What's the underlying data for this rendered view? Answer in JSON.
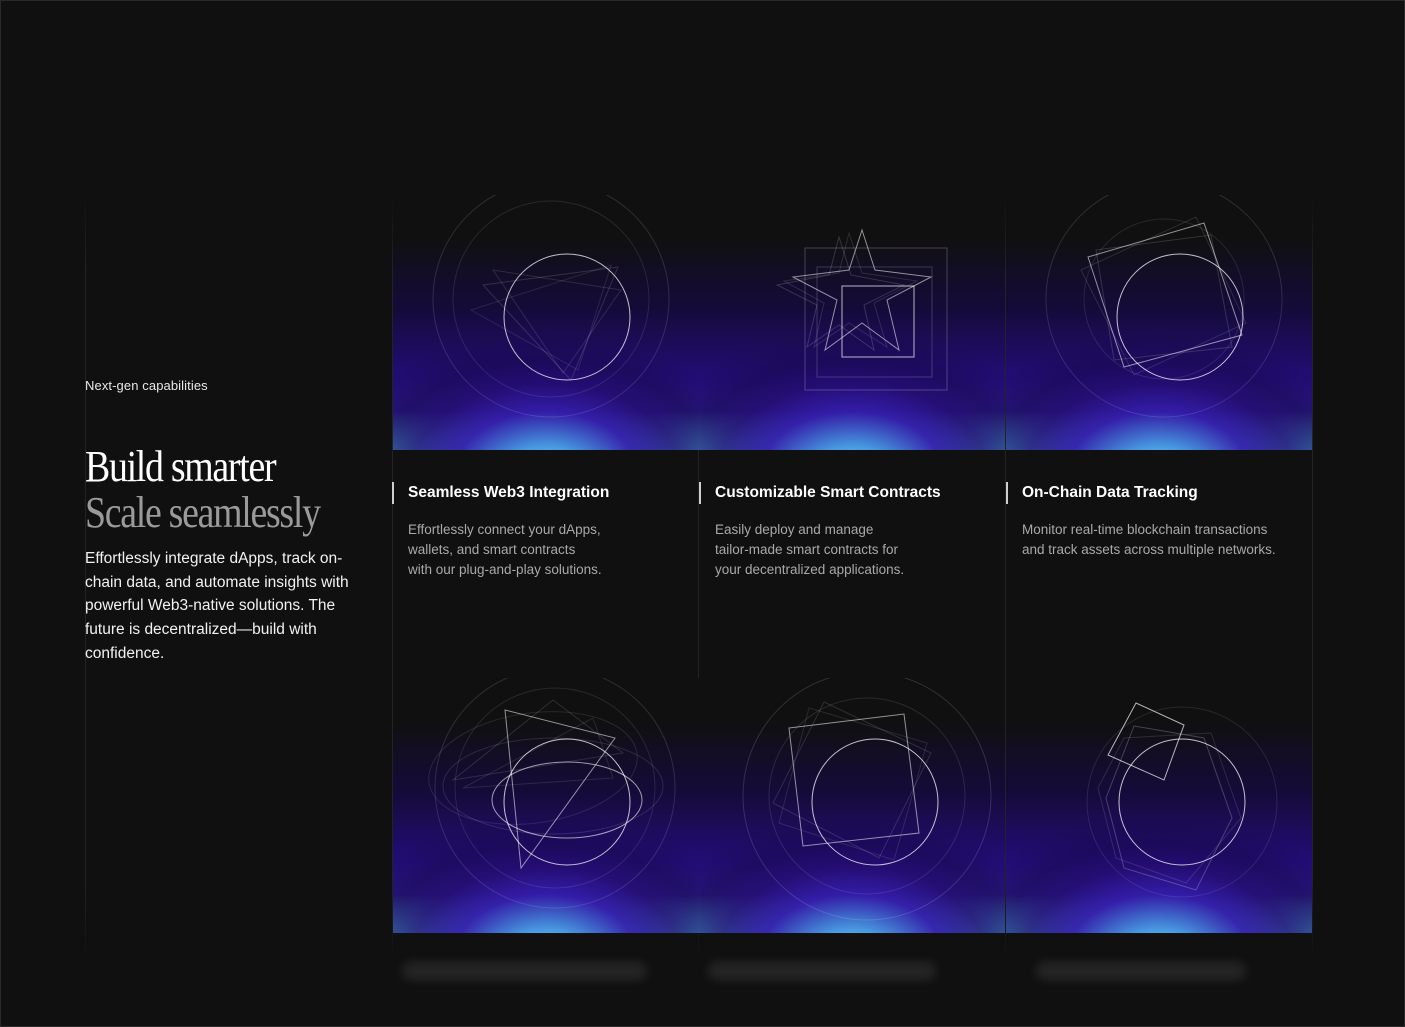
{
  "intro": {
    "eyebrow": "Next-gen capabilities",
    "headline_line1": "Build smarter",
    "headline_line2": "Scale seamlessly",
    "lead": "Effortlessly integrate dApps, track on-chain data, and automate insights with powerful Web3-native solutions. The future is decentralized—build with confidence."
  },
  "features": [
    {
      "title": "Seamless Web3 Integration",
      "description": "Effortlessly connect your dApps,\nwallets, and smart contracts\nwith our plug-and-play solutions.",
      "icon": "circle-triangle-icon"
    },
    {
      "title": "Customizable Smart Contracts",
      "description": "Easily deploy and manage\ntailor-made smart contracts for\nyour decentralized applications.",
      "icon": "star-square-icon"
    },
    {
      "title": "On-Chain Data Tracking",
      "description": "Monitor real-time blockchain transactions\nand track assets across multiple networks.",
      "icon": "circle-square-icon"
    }
  ],
  "bottom_row_icons": [
    "orbit-triangle-icon",
    "tilted-square-circle-icon",
    "hexagon-circle-icon"
  ],
  "colors": {
    "background": "#101010",
    "glow_purple": "#2a0f7a",
    "glow_cyan": "#5ab8e4"
  }
}
